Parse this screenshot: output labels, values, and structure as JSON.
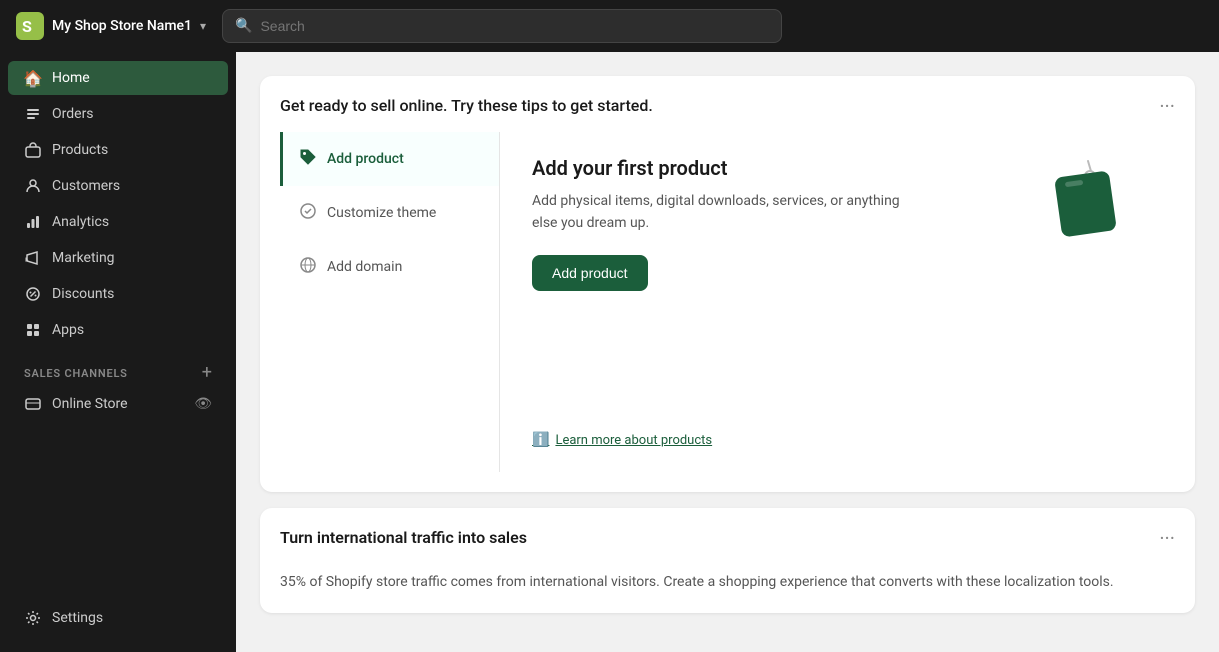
{
  "header": {
    "store_name": "My Shop Store Name1",
    "search_placeholder": "Search"
  },
  "sidebar": {
    "nav_items": [
      {
        "id": "home",
        "label": "Home",
        "icon": "🏠",
        "active": true
      },
      {
        "id": "orders",
        "label": "Orders",
        "icon": "📥",
        "active": false
      },
      {
        "id": "products",
        "label": "Products",
        "icon": "🏷️",
        "active": false
      },
      {
        "id": "customers",
        "label": "Customers",
        "icon": "👤",
        "active": false
      },
      {
        "id": "analytics",
        "label": "Analytics",
        "icon": "📊",
        "active": false
      },
      {
        "id": "marketing",
        "label": "Marketing",
        "icon": "📣",
        "active": false
      },
      {
        "id": "discounts",
        "label": "Discounts",
        "icon": "🏷",
        "active": false
      },
      {
        "id": "apps",
        "label": "Apps",
        "icon": "⊞",
        "active": false
      }
    ],
    "sales_channels_label": "SALES CHANNELS",
    "online_store_label": "Online Store",
    "settings_label": "Settings"
  },
  "main": {
    "card1": {
      "title": "Get ready to sell online. Try these tips to get started.",
      "menu_icon": "•••",
      "tips": [
        {
          "id": "add-product",
          "label": "Add product",
          "icon": "🏷️",
          "active": true
        },
        {
          "id": "customize-theme",
          "label": "Customize theme",
          "icon": "🎨",
          "active": false
        },
        {
          "id": "add-domain",
          "label": "Add domain",
          "icon": "🌐",
          "active": false
        }
      ],
      "detail": {
        "title": "Add your first product",
        "description": "Add physical items, digital downloads, services, or anything else you dream up.",
        "cta_label": "Add product",
        "learn_more_label": "Learn more about products"
      }
    },
    "card2": {
      "title": "Turn international traffic into sales",
      "description": "35% of Shopify store traffic comes from international visitors. Create a shopping experience that converts with these localization tools.",
      "menu_icon": "•••"
    }
  }
}
